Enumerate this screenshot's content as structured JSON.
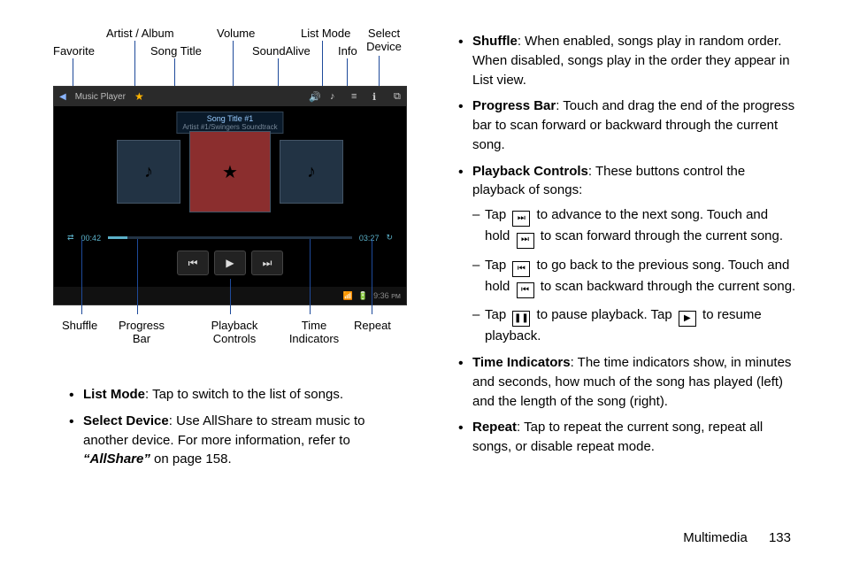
{
  "diagram": {
    "top_labels": {
      "favorite": "Favorite",
      "artist_album": "Artist / Album",
      "song_title": "Song Title",
      "volume": "Volume",
      "soundalive": "SoundAlive",
      "list_mode": "List Mode",
      "info": "Info",
      "select_device": "Select\nDevice"
    },
    "bottom_labels": {
      "shuffle": "Shuffle",
      "progress_bar": "Progress\nBar",
      "playback_controls": "Playback\nControls",
      "time_indicators": "Time\nIndicators",
      "repeat": "Repeat"
    },
    "screenshot": {
      "app_title": "Music Player",
      "now_playing_title": "Song Title #1",
      "now_playing_artist": "Artist #1/Swingers Soundtrack",
      "elapsed": "00:42",
      "total": "03:27",
      "shuffle_glyph": "⇄",
      "repeat_glyph": "↻",
      "prev_glyph": "⏮",
      "play_glyph": "▶",
      "next_glyph": "⏭"
    }
  },
  "col1_items": [
    {
      "term": "List Mode",
      "text": ": Tap to switch to the list of songs."
    },
    {
      "term": "Select Device",
      "text": ": Use AllShare to stream music to another device. For more information, refer to ",
      "link": "“AllShare”",
      "tail": "  on page 158."
    }
  ],
  "col2_items": {
    "shuffle": {
      "term": "Shuffle",
      "text": ": When enabled, songs play in random order. When disabled, songs play in the order they appear in List view."
    },
    "progress_bar": {
      "term": "Progress Bar",
      "text": ": Touch and drag the end of the progress bar to scan forward or backward through the current song."
    },
    "playback_controls": {
      "term": "Playback Controls",
      "text": ": These buttons control the playback of songs:"
    },
    "pc_next": {
      "pre": "Tap ",
      "mid": " to advance to the next song. Touch and hold ",
      "post": " to scan forward through the current song."
    },
    "pc_prev": {
      "pre": "Tap ",
      "mid": " to go back to the previous song. Touch and hold ",
      "post": " to scan backward through the current song."
    },
    "pc_pause": {
      "pre": "Tap ",
      "mid": " to pause playback. Tap ",
      "post": " to resume playback."
    },
    "time_indicators": {
      "term": "Time Indicators",
      "text": ": The time indicators show, in minutes and seconds, how much of the song has played (left) and the length of the song (right)."
    },
    "repeat": {
      "term": "Repeat",
      "text": ": Tap to repeat the current song, repeat all songs, or disable repeat mode."
    }
  },
  "icons": {
    "next": "⏭",
    "prev": "⏮",
    "pause": "❚❚",
    "play": "▶"
  },
  "footer": {
    "section": "Multimedia",
    "page": "133"
  }
}
